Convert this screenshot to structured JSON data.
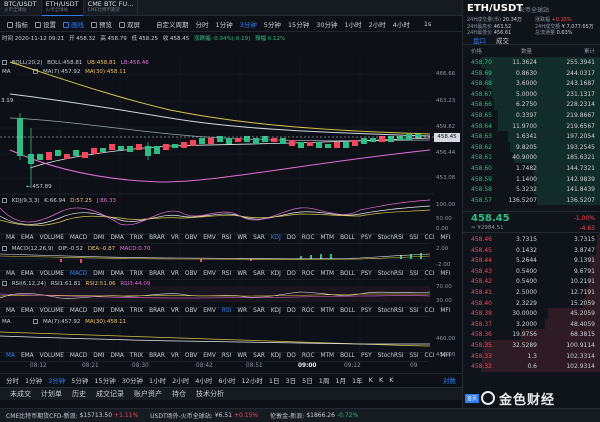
{
  "top_tabs": [
    {
      "title": "BTC/USDT",
      "sub": "火币全球站"
    },
    {
      "title": "ETH/USDT",
      "sub": "火币全球站"
    },
    {
      "title": "CME BTC FU...",
      "sub": "CME比特币期货"
    }
  ],
  "toolbar": {
    "indicator": "指标",
    "settings": "设置",
    "draw": "画线",
    "preview": "预览",
    "dual": "双屏",
    "intervals": [
      "自定义周期",
      "分时",
      "1分钟",
      "3分钟",
      "5分钟",
      "15分钟",
      "30分钟",
      "1小时",
      "2小时",
      "4小时"
    ],
    "selected": "3分钟",
    "more": "1s"
  },
  "info_line": {
    "time": "时间 2020-11-12 09:21",
    "open": "开 458.32",
    "high": "高 458.79",
    "low": "低 458.25",
    "close": "收 458.45",
    "change": "涨跌幅 -0.04%(-0.19)",
    "amplitude": "振幅 0.12%"
  },
  "boll": {
    "label": "BOLL(20,2)",
    "boll": "BOLL:458.81",
    "ub": "UB:458.81",
    "lb": "LB:456.46"
  },
  "ma_main": {
    "label": "MA",
    "ma7": "MA(7):457.92",
    "ma30": "MA(30):458.11"
  },
  "left_marker": "3.19",
  "low_marker": "457.89",
  "price_axis": [
    "466.66",
    "463.23",
    "459.82",
    "456.44",
    "453.08"
  ],
  "last_price": "458.45",
  "kdj": {
    "label": "KDJ(9,3,3)",
    "k": "K:66.94",
    "d": "D:57.25",
    "j": "J:86.33",
    "axis": [
      "100.00",
      "50.00",
      "0.00"
    ]
  },
  "indicator_tabs_1": [
    "MA",
    "EMA",
    "VOLUME",
    "MACD",
    "DMI",
    "DMA",
    "TRIX",
    "BRAR",
    "VR",
    "OBV",
    "EMV",
    "RSI",
    "WR",
    "SAR",
    "KDJ",
    "DO",
    "ROC",
    "MTM",
    "BOLL",
    "PSY",
    "StochRSI",
    "SSI",
    "CCI",
    "MFI"
  ],
  "indicator_tabs_1_sel": "KDJ",
  "macd": {
    "label": "MACD(12,26,9)",
    "dif": "DIF:-0.52",
    "dea": "DEA:-0.87",
    "macd": "MACD:0.70",
    "axis": [
      "2.00",
      "-2.00"
    ]
  },
  "indicator_tabs_2": [
    "MA",
    "EMA",
    "VOLUME",
    "MACD",
    "DMI",
    "DMA",
    "TRIX",
    "BRAR",
    "VR",
    "OBV",
    "EMV",
    "RSI",
    "WR",
    "SAR",
    "KDJ",
    "DO",
    "ROC",
    "MTM",
    "BOLL",
    "PSY",
    "StochRSI",
    "SSI",
    "CCI",
    "MFI"
  ],
  "indicator_tabs_2_sel": "MACD",
  "rsi": {
    "label": "RSI(6,12,24)",
    "r1": "RSI1:61.81",
    "r2": "RSI2:51.06",
    "r3": "RSI3:44.09",
    "axis": [
      "70.00",
      "30.00"
    ]
  },
  "indicator_tabs_3": [
    "MA",
    "EMA",
    "VOLUME",
    "MACD",
    "DMI",
    "DMA",
    "TRIX",
    "BRAR",
    "VR",
    "OBV",
    "EMV",
    "RSI",
    "WR",
    "SAR",
    "KDJ",
    "DO",
    "ROC",
    "MTM",
    "BOLL",
    "PSY",
    "StochRSI",
    "SSI",
    "CCI",
    "MFI"
  ],
  "indicator_tabs_3_sel": "RSI",
  "ma_sub": {
    "label": "MA",
    "ma7": "MA(7):457.92",
    "ma30": "MA(30):458.11",
    "axis": [
      "460.00",
      "450.00"
    ]
  },
  "indicator_tabs_4": [
    "MA",
    "EMA",
    "VOLUME",
    "MACD",
    "DMI",
    "DMA",
    "TRIX",
    "BRAR",
    "VR",
    "OBV",
    "EMV",
    "RSI",
    "WR",
    "SAR",
    "KDJ",
    "DO",
    "ROC",
    "MTM",
    "BOLL",
    "PSY",
    "StochRSI",
    "SSI",
    "CCI",
    "MFI"
  ],
  "indicator_tabs_4_sel": "MA",
  "time_axis": [
    "08:12",
    "08:21",
    "08:30",
    "08:42",
    "08:51",
    "09:00",
    "09:12",
    "09"
  ],
  "intervals_bottom": [
    "分时",
    "1分钟",
    "3分钟",
    "5分钟",
    "15分钟",
    "30分钟",
    "1小时",
    "2小时",
    "4小时",
    "6小时",
    "12小时",
    "1日",
    "3日",
    "5日",
    "1周",
    "1月",
    "1年",
    "K",
    "K",
    "K"
  ],
  "intervals_bottom_sel": "3分钟",
  "intervals_bottom_right": "对数",
  "trade_tabs": [
    "未成交",
    "计划单",
    "历史",
    "成交记录",
    "账户资产",
    "持仓",
    "技术分析"
  ],
  "status": [
    {
      "name": "CME比特币期货CFD-新浪:",
      "value": "$15713.50",
      "chg": "+1.11%",
      "up": true
    },
    {
      "name": "USDT场外-火币全球站:",
      "value": "¥6.51",
      "chg": "+0.15%",
      "up": true
    },
    {
      "name": "伦敦金-新浪:",
      "value": "$1866.26",
      "chg": "-0.72%",
      "up": false
    }
  ],
  "right_panel": {
    "symbol": "ETH/USDT",
    "exchange": "火币全球站",
    "stats": [
      {
        "k": "24H成交量(币)",
        "v": "20.34万"
      },
      {
        "k": "涨跌幅",
        "v": "+0.15%"
      },
      {
        "k": "24H最高价",
        "v": "463.52"
      },
      {
        "k": "24H成交额",
        "v": "¥ 7,077.65万"
      },
      {
        "k": "24H最低价",
        "v": "456.61"
      },
      {
        "k": "总流通量",
        "v": "0.63%"
      }
    ],
    "tabs": [
      "盘口",
      "成交"
    ],
    "tab_sel": "盘口",
    "head": [
      "价格",
      "数量",
      "累计"
    ],
    "asks": [
      [
        "458.70",
        "11.3624",
        "255.3941"
      ],
      [
        "458.69",
        "0.8630",
        "244.0317"
      ],
      [
        "458.68",
        "3.6000",
        "243.1687"
      ],
      [
        "458.67",
        "5.0000",
        "231.1317"
      ],
      [
        "458.66",
        "6.2750",
        "228.2314"
      ],
      [
        "458.65",
        "0.3397",
        "219.8667"
      ],
      [
        "458.64",
        "11.9700",
        "219.6567"
      ],
      [
        "458.63",
        "1.6341",
        "197.2054"
      ],
      [
        "458.62",
        "9.8205",
        "193.2545"
      ],
      [
        "458.61",
        "40.9000",
        "185.6321"
      ],
      [
        "458.60",
        "1.7482",
        "144.7321"
      ],
      [
        "458.59",
        "1.1400",
        "142.9839"
      ],
      [
        "458.58",
        "5.3232",
        "141.8439"
      ],
      [
        "458.57",
        "136.5207",
        "136.5207"
      ]
    ],
    "mid": {
      "price": "458.45",
      "cny": "≈ ¥2984.51",
      "pct": "-1.00%",
      "chg": "-4.63"
    },
    "bids": [
      [
        "458.46",
        "3.7315",
        "3.7315"
      ],
      [
        "458.45",
        "0.1432",
        "3.8747"
      ],
      [
        "458.44",
        "5.2644",
        "9.1391"
      ],
      [
        "458.43",
        "0.5400",
        "9.6791"
      ],
      [
        "458.42",
        "0.5400",
        "10.2191"
      ],
      [
        "458.41",
        "2.5000",
        "12.7191"
      ],
      [
        "458.40",
        "2.3229",
        "15.2059"
      ],
      [
        "458.38",
        "30.0000",
        "45.2059"
      ],
      [
        "458.37",
        "3.2000",
        "48.4059"
      ],
      [
        "458.36",
        "19.9756",
        "68.3815"
      ],
      [
        "458.35",
        "32.5289",
        "100.9114"
      ],
      [
        "458.33",
        "1.3",
        "102.3314"
      ],
      [
        "458.32",
        "0.6",
        "102.9314"
      ]
    ]
  },
  "watermark": {
    "badge": "首页",
    "text": "金色财经"
  }
}
